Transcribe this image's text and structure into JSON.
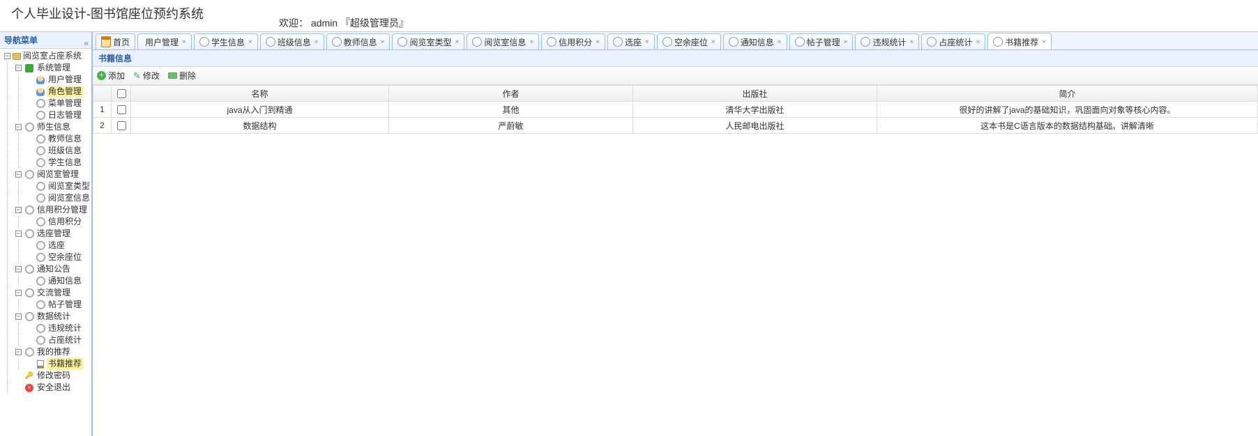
{
  "header": {
    "title": "个人毕业设计-图书馆座位预约系统",
    "welcome_prefix": "欢迎：",
    "user": "admin",
    "role": "『超级管理员』"
  },
  "sidebar": {
    "title": "导航菜单",
    "tree": {
      "root": "阅览室占座系统",
      "groups": [
        {
          "label": "系统管理",
          "icon": "green-box",
          "children": [
            {
              "label": "用户管理",
              "icon": "user-i"
            },
            {
              "label": "角色管理",
              "icon": "user-i",
              "selected": true
            },
            {
              "label": "菜单管理",
              "icon": "gear-icon"
            },
            {
              "label": "日志管理",
              "icon": "gear-icon"
            }
          ]
        },
        {
          "label": "师生信息",
          "icon": "gear-icon",
          "children": [
            {
              "label": "教师信息",
              "icon": "gear-icon"
            },
            {
              "label": "班级信息",
              "icon": "gear-icon"
            },
            {
              "label": "学生信息",
              "icon": "gear-icon"
            }
          ]
        },
        {
          "label": "阅览室管理",
          "icon": "gear-icon",
          "children": [
            {
              "label": "阅览室类型",
              "icon": "gear-icon"
            },
            {
              "label": "阅览室信息",
              "icon": "gear-icon"
            }
          ]
        },
        {
          "label": "信用积分管理",
          "icon": "gear-icon",
          "children": [
            {
              "label": "信用积分",
              "icon": "gear-icon"
            }
          ]
        },
        {
          "label": "选座管理",
          "icon": "gear-icon",
          "children": [
            {
              "label": "选座",
              "icon": "gear-icon"
            },
            {
              "label": "空余座位",
              "icon": "gear-icon"
            }
          ]
        },
        {
          "label": "通知公告",
          "icon": "gear-icon",
          "children": [
            {
              "label": "通知信息",
              "icon": "gear-icon"
            }
          ]
        },
        {
          "label": "交流管理",
          "icon": "gear-icon",
          "children": [
            {
              "label": "帖子管理",
              "icon": "gear-icon"
            }
          ]
        },
        {
          "label": "数据统计",
          "icon": "gear-icon",
          "children": [
            {
              "label": "违规统计",
              "icon": "gear-icon"
            },
            {
              "label": "占座统计",
              "icon": "gear-icon"
            }
          ]
        },
        {
          "label": "我的推荐",
          "icon": "gear-icon",
          "children": [
            {
              "label": "书籍推荐",
              "icon": "book-i",
              "selected": true
            }
          ]
        }
      ],
      "extras": [
        {
          "label": "修改密码",
          "icon": "key-i"
        },
        {
          "label": "安全退出",
          "icon": "exit-i"
        }
      ]
    }
  },
  "tabs": [
    {
      "label": "首页",
      "icon": "home",
      "closable": false
    },
    {
      "label": "用户管理",
      "icon": "user",
      "closable": true
    },
    {
      "label": "学生信息",
      "icon": "gear",
      "closable": true
    },
    {
      "label": "班级信息",
      "icon": "gear",
      "closable": true
    },
    {
      "label": "教师信息",
      "icon": "gear",
      "closable": true
    },
    {
      "label": "阅览室类型",
      "icon": "gear",
      "closable": true
    },
    {
      "label": "阅览室信息",
      "icon": "gear",
      "closable": true
    },
    {
      "label": "信用积分",
      "icon": "gear",
      "closable": true
    },
    {
      "label": "选座",
      "icon": "gear",
      "closable": true
    },
    {
      "label": "空余座位",
      "icon": "gear",
      "closable": true
    },
    {
      "label": "通知信息",
      "icon": "gear",
      "closable": true
    },
    {
      "label": "帖子管理",
      "icon": "gear",
      "closable": true
    },
    {
      "label": "违规统计",
      "icon": "gear",
      "closable": true
    },
    {
      "label": "占座统计",
      "icon": "gear",
      "closable": true
    },
    {
      "label": "书籍推荐",
      "icon": "gear",
      "closable": true,
      "active": true
    }
  ],
  "panel": {
    "title": "书籍信息",
    "toolbar": {
      "add": "添加",
      "edit": "修改",
      "del": "删除"
    },
    "columns": [
      "名称",
      "作者",
      "出版社",
      "简介"
    ],
    "rows": [
      {
        "name": "java从入门到精通",
        "author": "其他",
        "publisher": "清华大学出版社",
        "desc": "很好的讲解了java的基础知识，巩固面向对象等核心内容。"
      },
      {
        "name": "数据结构",
        "author": "严蔚敏",
        "publisher": "人民邮电出版社",
        "desc": "这本书是C语言版本的数据结构基础。讲解清晰"
      }
    ]
  }
}
